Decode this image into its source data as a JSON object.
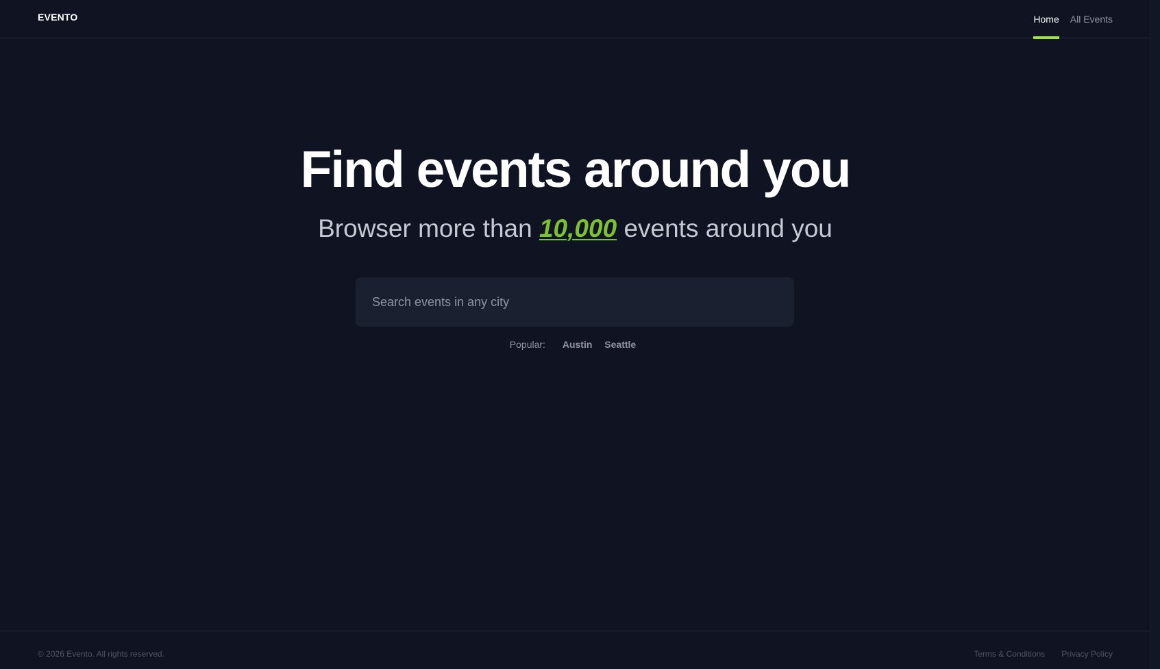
{
  "header": {
    "logo": "EVENTO",
    "nav": [
      {
        "label": "Home"
      },
      {
        "label": "All Events"
      }
    ]
  },
  "hero": {
    "title": "Find events around you",
    "subtitle_prefix": "Browser more than",
    "subtitle_highlight": "10,000",
    "subtitle_suffix": "events around you"
  },
  "search": {
    "placeholder": "Search events in any city",
    "value": ""
  },
  "popular": {
    "label": "Popular:",
    "cities": [
      "Austin",
      "Seattle"
    ]
  },
  "footer": {
    "copyright": "© 2026 Evento. All rights reserved.",
    "links": [
      "Terms & Conditions",
      "Privacy Policy"
    ]
  },
  "colors": {
    "background": "#0f1322",
    "accent": "#a3e635",
    "highlight": "#7cc034",
    "surface": "#1b2030"
  }
}
